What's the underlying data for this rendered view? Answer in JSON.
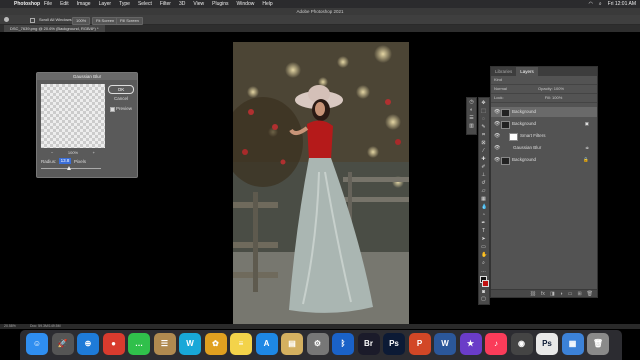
{
  "menubar": {
    "apple_glyph": "",
    "app_name": "Photoshop",
    "menus": [
      "File",
      "Edit",
      "Image",
      "Layer",
      "Type",
      "Select",
      "Filter",
      "3D",
      "View",
      "Plugins",
      "Window",
      "Help"
    ],
    "clock": "Fri 12:01 AM"
  },
  "titlebar": {
    "title": "Adobe Photoshop 2021"
  },
  "options": {
    "scroll_all": "Scroll All Windows",
    "zoom": "100%",
    "fit_screen": "Fit Screen",
    "fill_screen": "Fill Screen"
  },
  "doc_tab": {
    "label": "DSC_7639.png @ 20.6% (Background, RGB/8*) *"
  },
  "dialog": {
    "title": "Gaussian Blur",
    "ok": "OK",
    "cancel": "Cancel",
    "preview_label": "Preview",
    "zoom_minus": "−",
    "zoom_level": "100%",
    "zoom_plus": "+",
    "radius_label": "Radius:",
    "radius_value": "13.8",
    "radius_unit": "Pixels",
    "radius_fraction": 0.46
  },
  "layers_panel": {
    "tabs": [
      "Libraries",
      "Layers"
    ],
    "active_tab": "Layers",
    "filter_label": "Kind",
    "blend_mode": "Normal",
    "opacity_label": "Opacity: 100%",
    "lock_label": "Lock:",
    "fill_label": "Fill: 100%",
    "layers": [
      {
        "name": "Background",
        "indent": 0
      },
      {
        "name": "Background",
        "indent": 0
      },
      {
        "name": "Smart Filters",
        "indent": 1
      },
      {
        "name": "Gaussian Blur",
        "indent": 2
      },
      {
        "name": "Background",
        "indent": 0
      }
    ]
  },
  "statusbar": {
    "zoom": "20.58%",
    "doc": "Doc: 59.3M/149.5M"
  },
  "dock": [
    {
      "name": "finder-icon",
      "glyph": "☺",
      "color": "#2f8ef0"
    },
    {
      "name": "launchpad-icon",
      "glyph": "🚀",
      "color": "#555"
    },
    {
      "name": "safari-icon",
      "glyph": "⊕",
      "color": "#1e7bd8"
    },
    {
      "name": "chrome-icon",
      "glyph": "●",
      "color": "#d83b2e"
    },
    {
      "name": "messages-icon",
      "glyph": "…",
      "color": "#30c04b"
    },
    {
      "name": "contacts-icon",
      "glyph": "☰",
      "color": "#b08a50"
    },
    {
      "name": "app-w-icon",
      "glyph": "W",
      "color": "#18a8d8"
    },
    {
      "name": "photos-icon",
      "glyph": "✿",
      "color": "#e0a020"
    },
    {
      "name": "notes-icon",
      "glyph": "≡",
      "color": "#f3d34a"
    },
    {
      "name": "appstore-icon",
      "glyph": "A",
      "color": "#1e88e5"
    },
    {
      "name": "preview-icon",
      "glyph": "▤",
      "color": "#d4b060"
    },
    {
      "name": "system-prefs-icon",
      "glyph": "⚙",
      "color": "#777"
    },
    {
      "name": "bluetooth-icon",
      "glyph": "ᛒ",
      "color": "#1a62c8"
    },
    {
      "name": "bridge-icon",
      "glyph": "Br",
      "color": "#1b1b2a"
    },
    {
      "name": "photoshop-icon",
      "glyph": "Ps",
      "color": "#0c1a35"
    },
    {
      "name": "powerpoint-icon",
      "glyph": "P",
      "color": "#d24726"
    },
    {
      "name": "word-icon",
      "glyph": "W",
      "color": "#2b579a"
    },
    {
      "name": "imovie-icon",
      "glyph": "★",
      "color": "#6a3cc8"
    },
    {
      "name": "music-icon",
      "glyph": "♪",
      "color": "#fa3c5a"
    },
    {
      "name": "camera-icon",
      "glyph": "◉",
      "color": "#444"
    },
    {
      "name": "ps-doc-icon",
      "glyph": "Ps",
      "color": "#e8e8e8"
    },
    {
      "name": "folder-icon",
      "glyph": "▦",
      "color": "#3c82d8"
    },
    {
      "name": "trash-icon",
      "glyph": "🗑",
      "color": "#8a8a8a"
    }
  ]
}
